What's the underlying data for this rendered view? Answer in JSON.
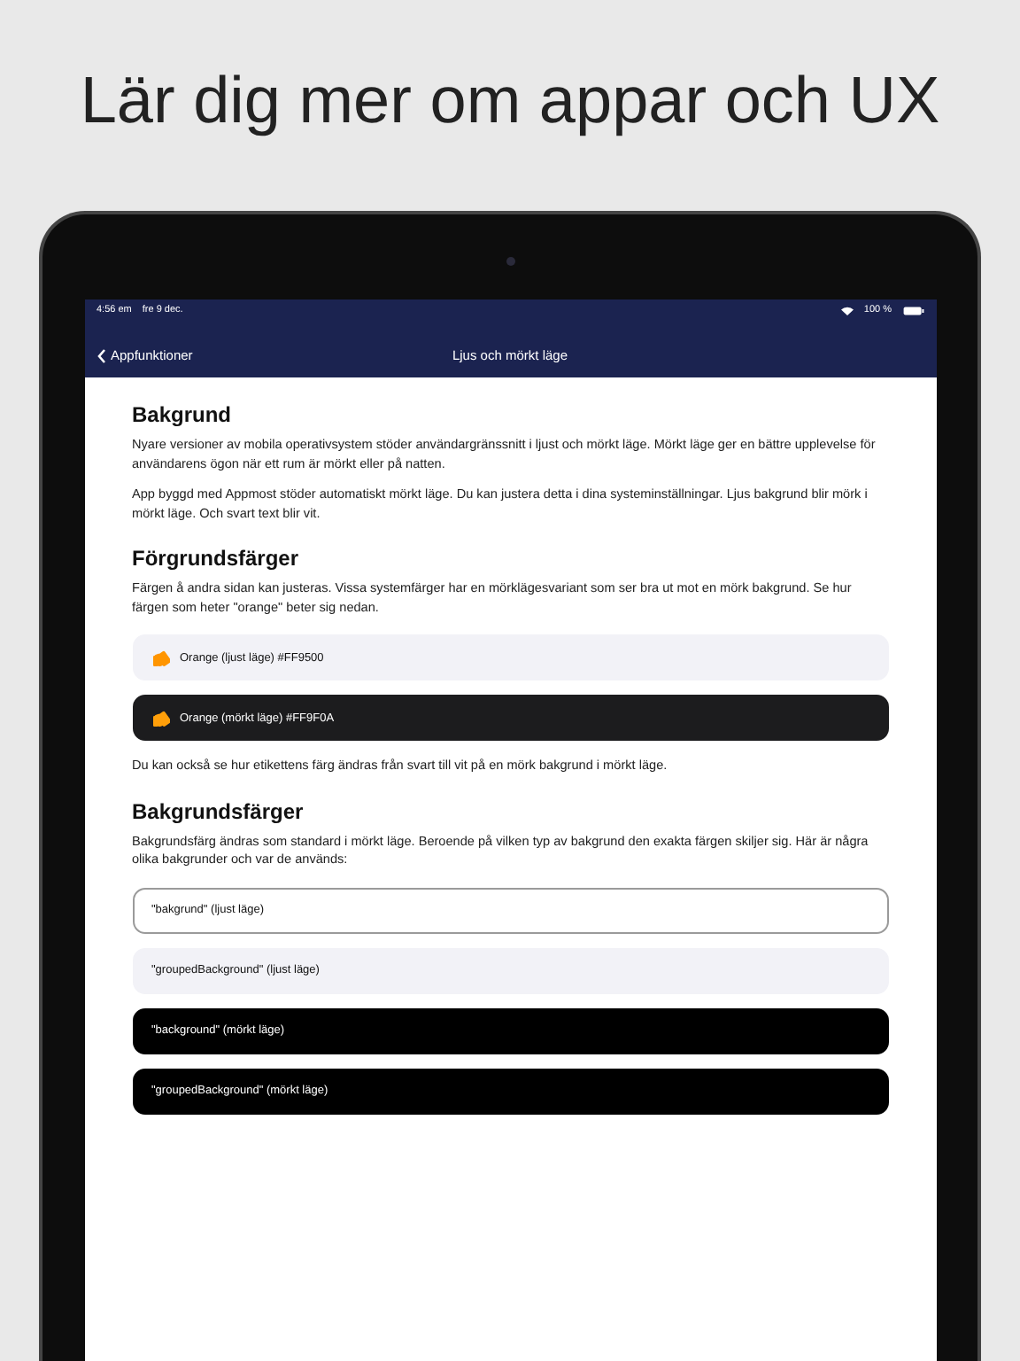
{
  "headline": "Lär dig mer om appar och UX",
  "status_bar": {
    "time": "4:56 em",
    "date": "fre 9 dec.",
    "battery": "100 %"
  },
  "nav": {
    "back": "Appfunktioner",
    "title": "Ljus och mörkt läge"
  },
  "sections": [
    {
      "heading": "Bakgrund",
      "paragraphs": [
        "Nyare versioner av mobila operativsystem stöder användargränssnitt i ljust och mörkt läge. Mörkt läge ger en bättre upplevelse för användarens ögon när ett rum är mörkt eller på natten.",
        "App byggd med Appmost stöder automatiskt mörkt läge. Du kan justera detta i dina systeminställningar. Ljus bakgrund blir mörk i mörkt läge. Och svart text blir vit."
      ]
    },
    {
      "heading": "Förgrundsfärger",
      "paragraphs": [
        "Färgen å andra sidan kan justeras. Vissa systemfärger har en mörklägesvariant som ser bra ut mot en mörk bakgrund. Se hur färgen som heter \"orange\" beter sig nedan."
      ],
      "rows": [
        {
          "kind": "grouped-light",
          "label": "Orange (ljust läge) #FF9500",
          "color": "#ff9500"
        },
        {
          "kind": "grouped-dark",
          "label": "Orange (mörkt läge) #FF9F0A",
          "color": "#ff9f0a"
        }
      ],
      "after": [
        "Du kan också se hur etikettens färg ändras från svart till vit på en mörk bakgrund i mörkt läge."
      ]
    },
    {
      "heading": "Bakgrundsfärger",
      "paragraphs": [
        "Bakgrundsfärg ändras som standard i mörkt läge. Beroende på vilken typ av bakgrund den exakta färgen skiljer sig. Här är några olika bakgrunder och var de används:"
      ],
      "rows": [
        {
          "kind": "outlined",
          "label": "\"bakgrund\" (ljust läge)"
        },
        {
          "kind": "grouped-light",
          "label": "\"groupedBackground\" (ljust läge)"
        },
        {
          "kind": "black",
          "label": "\"background\" (mörkt läge)"
        },
        {
          "kind": "black",
          "label": "\"groupedBackground\" (mörkt läge)"
        }
      ]
    }
  ]
}
